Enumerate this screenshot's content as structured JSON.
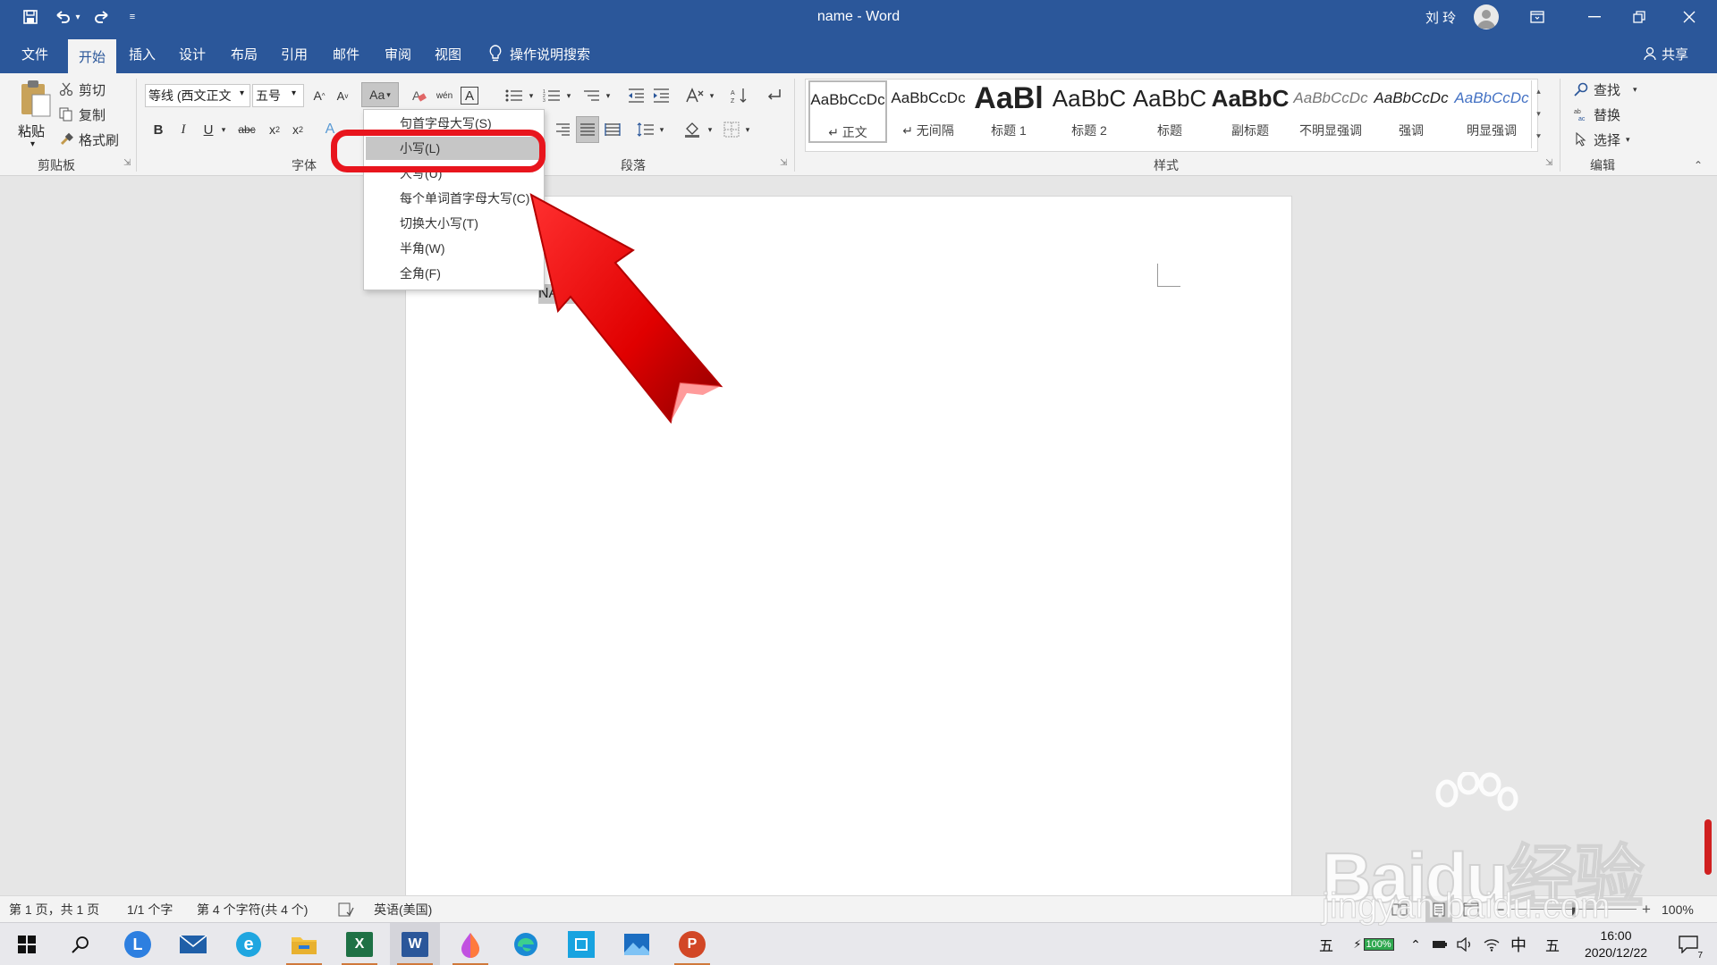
{
  "titlebar": {
    "doc_title": "name - Word",
    "user_name": "刘 玲",
    "quick_access": [
      "save-icon",
      "undo-icon",
      "redo-icon",
      "customize-icon"
    ]
  },
  "tabs": {
    "items": [
      "文件",
      "开始",
      "插入",
      "设计",
      "布局",
      "引用",
      "邮件",
      "审阅",
      "视图"
    ],
    "active": "开始",
    "tell_me": "操作说明搜索",
    "share": "共享"
  },
  "clipboard": {
    "paste": "粘贴",
    "cut": "剪切",
    "copy": "复制",
    "format_painter": "格式刷",
    "label": "剪贴板"
  },
  "font": {
    "name": "等线 (西文正文",
    "size": "五号",
    "change_case": "Aa",
    "label": "字体"
  },
  "paragraph": {
    "label": "段落"
  },
  "styles": {
    "label": "样式",
    "items": [
      {
        "preview": "AaBbCcDc",
        "name": "↵ 正文"
      },
      {
        "preview": "AaBbCcDc",
        "name": "↵ 无间隔"
      },
      {
        "preview": "AaBl",
        "name": "标题 1"
      },
      {
        "preview": "AaBbC",
        "name": "标题 2"
      },
      {
        "preview": "AaBbC",
        "name": "标题"
      },
      {
        "preview": "AaBbC",
        "name": "副标题"
      },
      {
        "preview": "AaBbCcDc",
        "name": "不明显强调"
      },
      {
        "preview": "AaBbCcDc",
        "name": "强调"
      },
      {
        "preview": "AaBbCcDc",
        "name": "明显强调"
      }
    ]
  },
  "editing": {
    "find": "查找",
    "replace": "替换",
    "select": "选择",
    "label": "编辑"
  },
  "change_case_menu": {
    "items": [
      "句首字母大写(S)",
      "小写(L)",
      "大写(U)",
      "每个单词首字母大写(C)",
      "切换大小写(T)",
      "半角(W)",
      "全角(F)"
    ],
    "highlighted": "小写(L)"
  },
  "document": {
    "text": "NAME",
    "para_mark": "↵"
  },
  "status": {
    "page": "第 1 页，共 1 页",
    "words": "1/1 个字",
    "chars": "第 4 个字符(共 4 个)",
    "language": "英语(美国)",
    "zoom": "100%"
  },
  "taskbar": {
    "apps": [
      "windows-start",
      "search",
      "lenovo-app",
      "mail-app",
      "edge-legacy",
      "file-explorer",
      "excel",
      "word",
      "paint3d",
      "edge",
      "store-app",
      "photos",
      "powerpoint"
    ],
    "ime_mode": "五",
    "battery": "100%",
    "lang": "中",
    "ime2": "五",
    "time": "16:00",
    "date": "2020/12/22",
    "notifications": "7"
  },
  "watermark": {
    "brand": "Baidu经验",
    "url": "jingyan.baidu.com"
  },
  "colors": {
    "word_blue": "#2b579a",
    "highlight_red": "#e8151d",
    "menu_highlight": "#c6c6c6"
  }
}
